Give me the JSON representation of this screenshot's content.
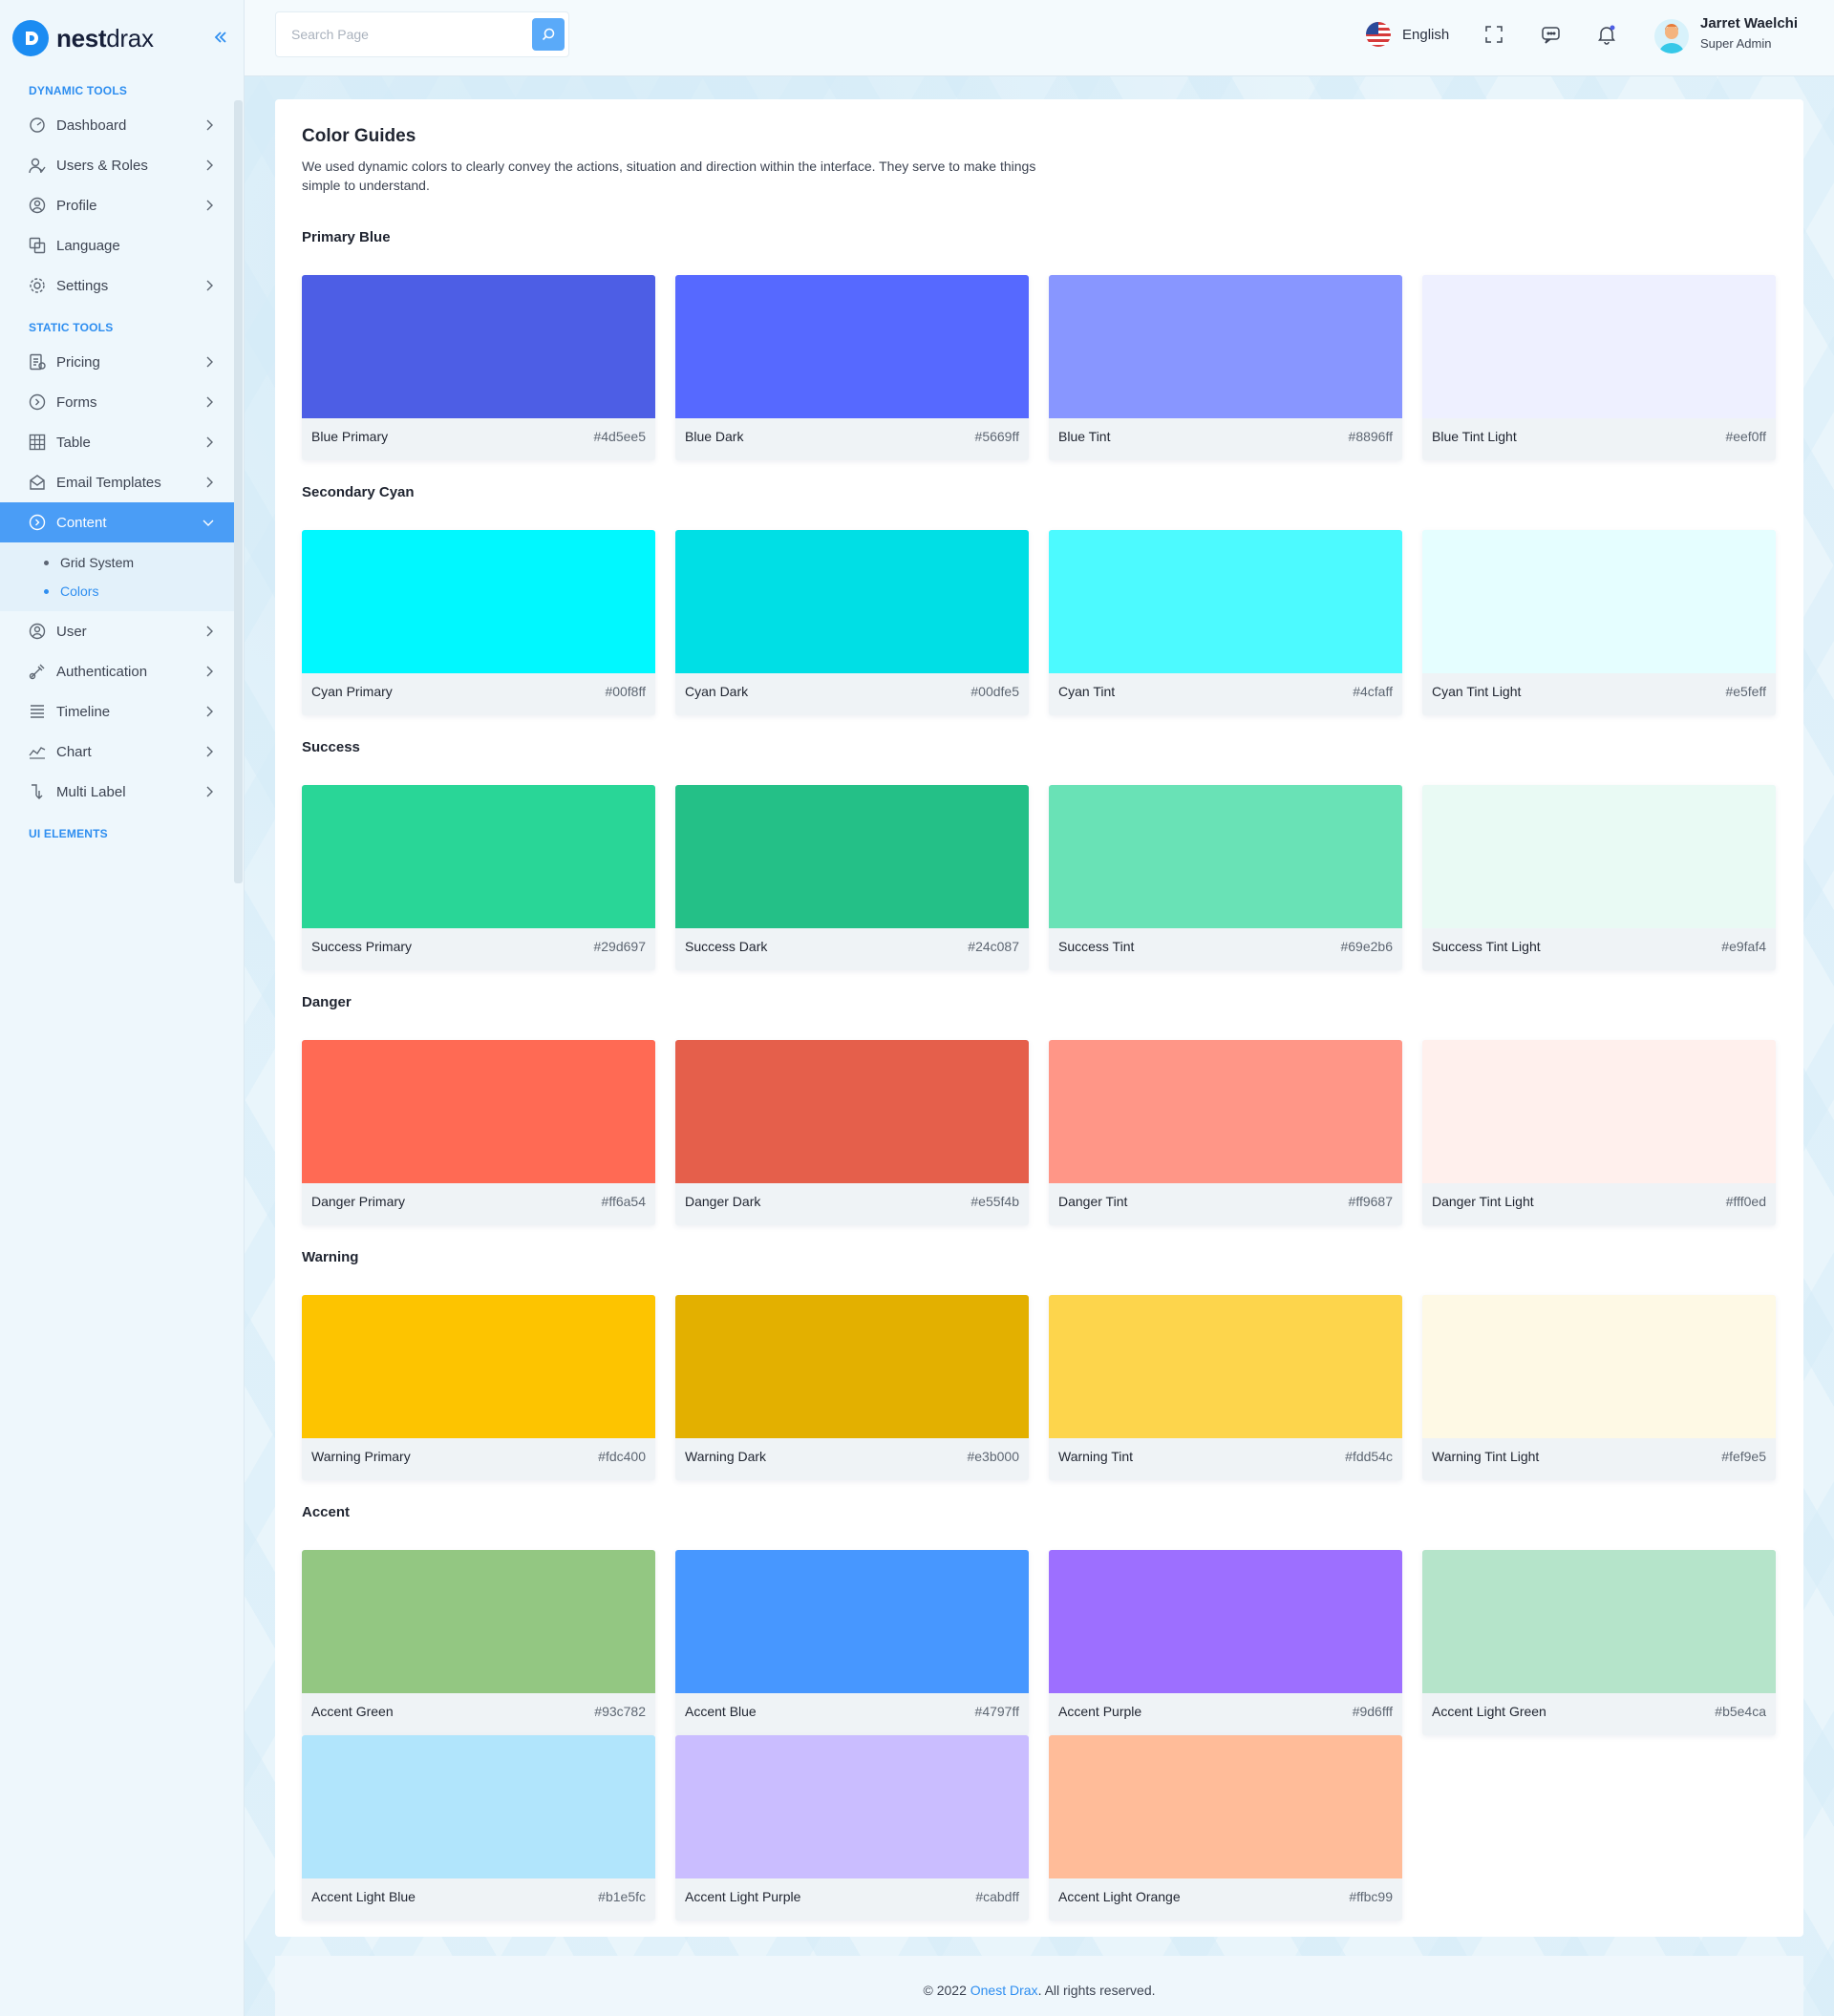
{
  "brand": {
    "name_bold": "nest",
    "name_light": "drax"
  },
  "search": {
    "placeholder": "Search Page"
  },
  "header": {
    "language": "English",
    "user_name": "Jarret Waelchi",
    "user_role": "Super Admin"
  },
  "sidebar": {
    "sections": [
      {
        "title": "Dynamic Tools",
        "items": [
          {
            "label": "Dashboard",
            "icon": "dashboard-icon",
            "chevron": true
          },
          {
            "label": "Users & Roles",
            "icon": "users-icon",
            "chevron": true
          },
          {
            "label": "Profile",
            "icon": "profile-icon",
            "chevron": true
          },
          {
            "label": "Language",
            "icon": "language-icon",
            "chevron": false
          },
          {
            "label": "Settings",
            "icon": "gear-icon",
            "chevron": true
          }
        ]
      },
      {
        "title": "Static Tools",
        "items": [
          {
            "label": "Pricing",
            "icon": "pricing-icon",
            "chevron": true
          },
          {
            "label": "Forms",
            "icon": "forms-icon",
            "chevron": true
          },
          {
            "label": "Table",
            "icon": "table-icon",
            "chevron": true
          },
          {
            "label": "Email Templates",
            "icon": "email-icon",
            "chevron": true
          },
          {
            "label": "Content",
            "icon": "content-icon",
            "chevron": true,
            "active": true,
            "children": [
              {
                "label": "Grid System",
                "active": false
              },
              {
                "label": "Colors",
                "active": true
              }
            ]
          },
          {
            "label": "User",
            "icon": "user-icon",
            "chevron": true
          },
          {
            "label": "Authentication",
            "icon": "lock-icon",
            "chevron": true
          },
          {
            "label": "Timeline",
            "icon": "timeline-icon",
            "chevron": true
          },
          {
            "label": "Chart",
            "icon": "chart-icon",
            "chevron": true
          },
          {
            "label": "Multi Label",
            "icon": "multi-label-icon",
            "chevron": true
          }
        ]
      },
      {
        "title": "UI Elements",
        "items": []
      }
    ]
  },
  "content": {
    "title": "Color Guides",
    "description": "We used dynamic colors to clearly convey the actions, situation and direction within the interface. They serve to make things simple to understand.",
    "groups": [
      {
        "title": "Primary Blue",
        "colors": [
          {
            "name": "Blue Primary",
            "hex": "#4d5ee5"
          },
          {
            "name": "Blue Dark",
            "hex": "#5669ff"
          },
          {
            "name": "Blue Tint",
            "hex": "#8896ff"
          },
          {
            "name": "Blue Tint Light",
            "hex": "#eef0ff"
          }
        ]
      },
      {
        "title": "Secondary Cyan",
        "colors": [
          {
            "name": "Cyan Primary",
            "hex": "#00f8ff"
          },
          {
            "name": "Cyan Dark",
            "hex": "#00dfe5"
          },
          {
            "name": "Cyan Tint",
            "hex": "#4cfaff"
          },
          {
            "name": "Cyan Tint Light",
            "hex": "#e5feff"
          }
        ]
      },
      {
        "title": "Success",
        "colors": [
          {
            "name": "Success Primary",
            "hex": "#29d697"
          },
          {
            "name": "Success Dark",
            "hex": "#24c087"
          },
          {
            "name": "Success Tint",
            "hex": "#69e2b6"
          },
          {
            "name": "Success Tint Light",
            "hex": "#e9faf4"
          }
        ]
      },
      {
        "title": "Danger",
        "colors": [
          {
            "name": "Danger Primary",
            "hex": "#ff6a54"
          },
          {
            "name": "Danger Dark",
            "hex": "#e55f4b"
          },
          {
            "name": "Danger Tint",
            "hex": "#ff9687"
          },
          {
            "name": "Danger Tint Light",
            "hex": "#fff0ed"
          }
        ]
      },
      {
        "title": "Warning",
        "colors": [
          {
            "name": "Warning Primary",
            "hex": "#fdc400"
          },
          {
            "name": "Warning Dark",
            "hex": "#e3b000"
          },
          {
            "name": "Warning Tint",
            "hex": "#fdd54c"
          },
          {
            "name": "Warning Tint Light",
            "hex": "#fef9e5"
          }
        ]
      },
      {
        "title": "Accent",
        "colors": [
          {
            "name": "Accent Green",
            "hex": "#93c782"
          },
          {
            "name": "Accent Blue",
            "hex": "#4797ff"
          },
          {
            "name": "Accent Purple",
            "hex": "#9d6fff"
          },
          {
            "name": "Accent Light Green",
            "hex": "#b5e4ca"
          },
          {
            "name": "Accent Light Blue",
            "hex": "#b1e5fc"
          },
          {
            "name": "Accent Light Purple",
            "hex": "#cabdff"
          },
          {
            "name": "Accent Light Orange",
            "hex": "#ffbc99"
          }
        ]
      }
    ]
  },
  "footer": {
    "prefix": "© 2022 ",
    "link": "Onest Drax",
    "suffix": ". All rights reserved."
  }
}
